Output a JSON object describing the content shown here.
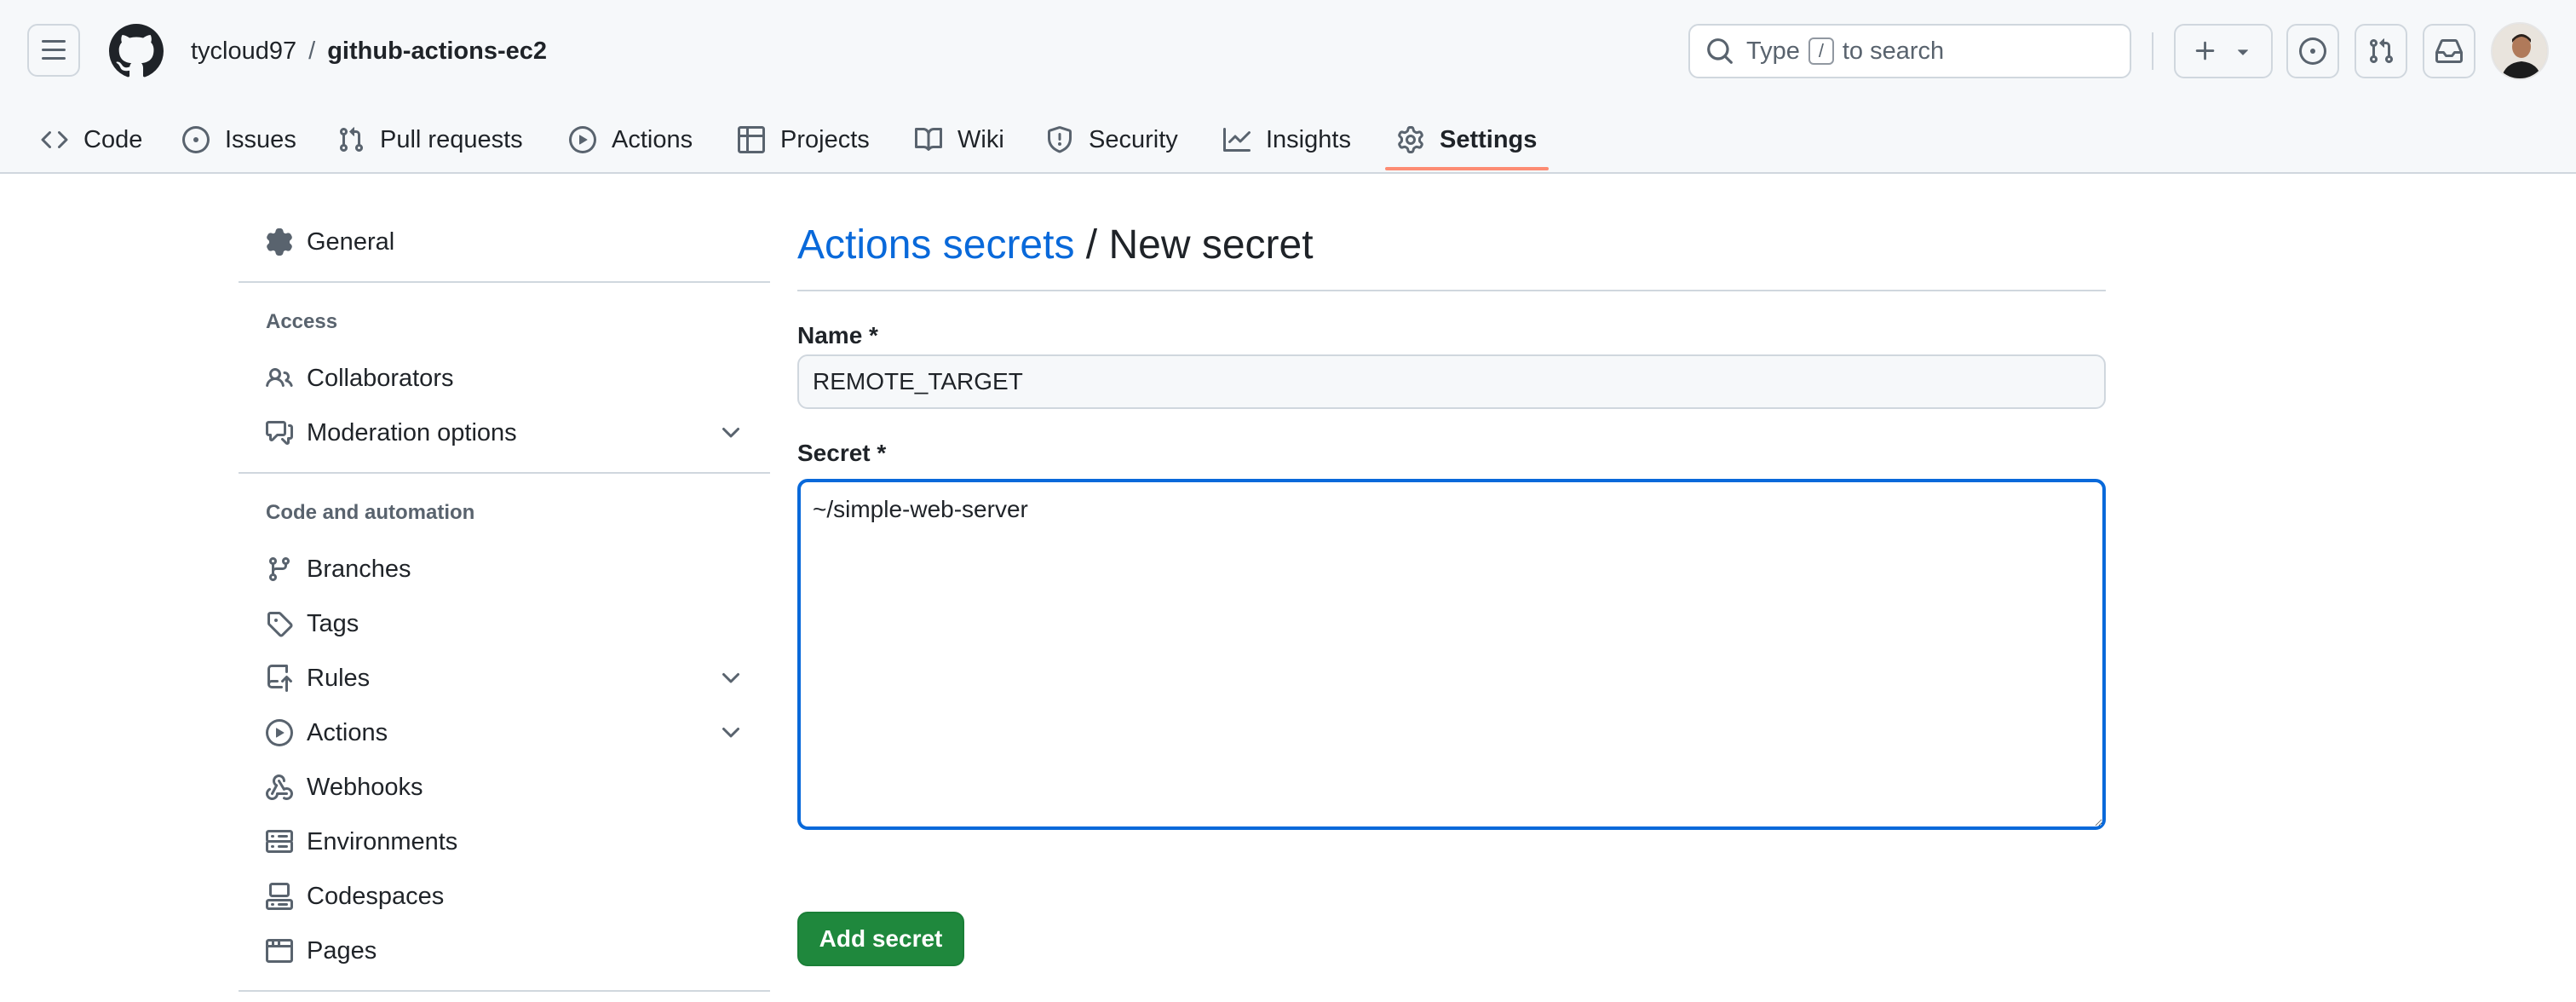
{
  "header": {
    "owner": "tycloud97",
    "separator": "/",
    "repo": "github-actions-ec2",
    "search": {
      "prefix": "Type",
      "key": "/",
      "suffix": "to search"
    }
  },
  "tabs": [
    {
      "label": "Code",
      "icon": "code-icon"
    },
    {
      "label": "Issues",
      "icon": "issue-opened-icon"
    },
    {
      "label": "Pull requests",
      "icon": "git-pull-request-icon"
    },
    {
      "label": "Actions",
      "icon": "play-icon"
    },
    {
      "label": "Projects",
      "icon": "table-icon"
    },
    {
      "label": "Wiki",
      "icon": "book-icon"
    },
    {
      "label": "Security",
      "icon": "shield-icon"
    },
    {
      "label": "Insights",
      "icon": "graph-icon"
    },
    {
      "label": "Settings",
      "icon": "gear-icon",
      "active": true
    }
  ],
  "sidebar": {
    "general": "General",
    "access_heading": "Access",
    "access_items": [
      {
        "label": "Collaborators",
        "icon": "people-icon"
      },
      {
        "label": "Moderation options",
        "icon": "comment-discussion-icon",
        "expandable": true
      }
    ],
    "code_heading": "Code and automation",
    "code_items": [
      {
        "label": "Branches",
        "icon": "git-branch-icon"
      },
      {
        "label": "Tags",
        "icon": "tag-icon"
      },
      {
        "label": "Rules",
        "icon": "repo-push-icon",
        "expandable": true
      },
      {
        "label": "Actions",
        "icon": "play-icon",
        "expandable": true
      },
      {
        "label": "Webhooks",
        "icon": "webhook-icon"
      },
      {
        "label": "Environments",
        "icon": "server-icon"
      },
      {
        "label": "Codespaces",
        "icon": "codespaces-icon"
      },
      {
        "label": "Pages",
        "icon": "browser-icon"
      }
    ]
  },
  "main": {
    "title_link": "Actions secrets",
    "title_rest": " / New secret",
    "name_label": "Name *",
    "name_value": "REMOTE_TARGET",
    "secret_label": "Secret *",
    "secret_value": "~/simple-web-server",
    "submit_label": "Add secret"
  },
  "colors": {
    "accent": "#0969da",
    "primary_button": "#1f883d",
    "tab_underline": "#fd8c73"
  }
}
